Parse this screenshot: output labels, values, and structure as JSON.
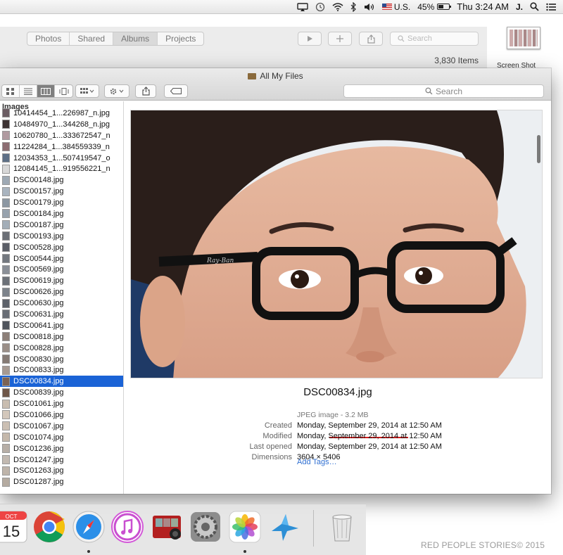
{
  "menubar": {
    "input_source": "U.S.",
    "battery": "45%",
    "clock": "Thu 3:24 AM",
    "user": "J."
  },
  "photos_app": {
    "tabs": [
      "Photos",
      "Shared",
      "Albums",
      "Projects"
    ],
    "active_tab": "Albums",
    "search_placeholder": "Search",
    "item_count": "3,830 Items"
  },
  "desktop": {
    "screenshot_label": "Screen Shot"
  },
  "finder": {
    "title": "All My Files",
    "search_placeholder": "Search",
    "sidebar_header": "Images",
    "files": [
      {
        "name": "10414454_1...226987_n.jpg",
        "thumb": "#6b5d63"
      },
      {
        "name": "10484970_1...344268_n.jpg",
        "thumb": "#3d3333"
      },
      {
        "name": "10620780_1...333672547_n",
        "thumb": "#b09aa0"
      },
      {
        "name": "11224284_1...384559339_n",
        "thumb": "#8c6d72"
      },
      {
        "name": "12034353_1...507419547_o",
        "thumb": "#5d6f86"
      },
      {
        "name": "12084145_1...919556221_n",
        "thumb": "#d8d8d8"
      },
      {
        "name": "DSC00148.jpg",
        "thumb": "#9ea9b4"
      },
      {
        "name": "DSC00157.jpg",
        "thumb": "#a9b4bf"
      },
      {
        "name": "DSC00179.jpg",
        "thumb": "#8c97a2"
      },
      {
        "name": "DSC00184.jpg",
        "thumb": "#97a2ad"
      },
      {
        "name": "DSC00187.jpg",
        "thumb": "#a3aeb8"
      },
      {
        "name": "DSC00193.jpg",
        "thumb": "#6b6f76"
      },
      {
        "name": "DSC00528.jpg",
        "thumb": "#5a5e66"
      },
      {
        "name": "DSC00544.jpg",
        "thumb": "#73787f"
      },
      {
        "name": "DSC00569.jpg",
        "thumb": "#8a8f97"
      },
      {
        "name": "DSC00619.jpg",
        "thumb": "#6c7178"
      },
      {
        "name": "DSC00626.jpg",
        "thumb": "#7d838b"
      },
      {
        "name": "DSC00630.jpg",
        "thumb": "#5c6169"
      },
      {
        "name": "DSC00631.jpg",
        "thumb": "#686d75"
      },
      {
        "name": "DSC00641.jpg",
        "thumb": "#4f545c"
      },
      {
        "name": "DSC00818.jpg",
        "thumb": "#8c7f78"
      },
      {
        "name": "DSC00828.jpg",
        "thumb": "#9a8e87"
      },
      {
        "name": "DSC00830.jpg",
        "thumb": "#857a74"
      },
      {
        "name": "DSC00833.jpg",
        "thumb": "#a79a92"
      },
      {
        "name": "DSC00834.jpg",
        "thumb": "#7b6254",
        "selected": true
      },
      {
        "name": "DSC00839.jpg",
        "thumb": "#6e5648"
      },
      {
        "name": "DSC01061.jpg",
        "thumb": "#c9bdb0"
      },
      {
        "name": "DSC01066.jpg",
        "thumb": "#d3c7bb"
      },
      {
        "name": "DSC01067.jpg",
        "thumb": "#cbbfb3"
      },
      {
        "name": "DSC01074.jpg",
        "thumb": "#c4b8ab"
      },
      {
        "name": "DSC01236.jpg",
        "thumb": "#b7aea6"
      },
      {
        "name": "DSC01247.jpg",
        "thumb": "#c2b9b1"
      },
      {
        "name": "DSC01263.jpg",
        "thumb": "#beb4aa"
      },
      {
        "name": "DSC01287.jpg",
        "thumb": "#b5aba1"
      }
    ],
    "preview": {
      "filename": "DSC00834.jpg",
      "kind": "JPEG image - 3.2 MB",
      "fields": [
        {
          "label": "Created",
          "value": "Monday, September 29, 2014 at 12:50 AM"
        },
        {
          "label": "Modified",
          "value": "Monday, September 29, 2014 at 12:50 AM"
        },
        {
          "label": "Last opened",
          "value": "Monday, September 29, 2014 at 12:50 AM"
        },
        {
          "label": "Dimensions",
          "value": "3604 × 5406"
        }
      ],
      "add_tags": "Add Tags…",
      "glasses_logo": "Ray-Ban"
    }
  },
  "dock": {
    "calendar_month": "OCT",
    "calendar_day": "15",
    "apps": [
      "calendar-icon",
      "chrome-icon",
      "safari-icon",
      "itunes-icon",
      "photo-booth-icon",
      "system-preferences-icon",
      "photos-icon",
      "migration-icon",
      "trash-icon"
    ]
  },
  "watermark": "RED PEOPLE STORIES© 2015"
}
